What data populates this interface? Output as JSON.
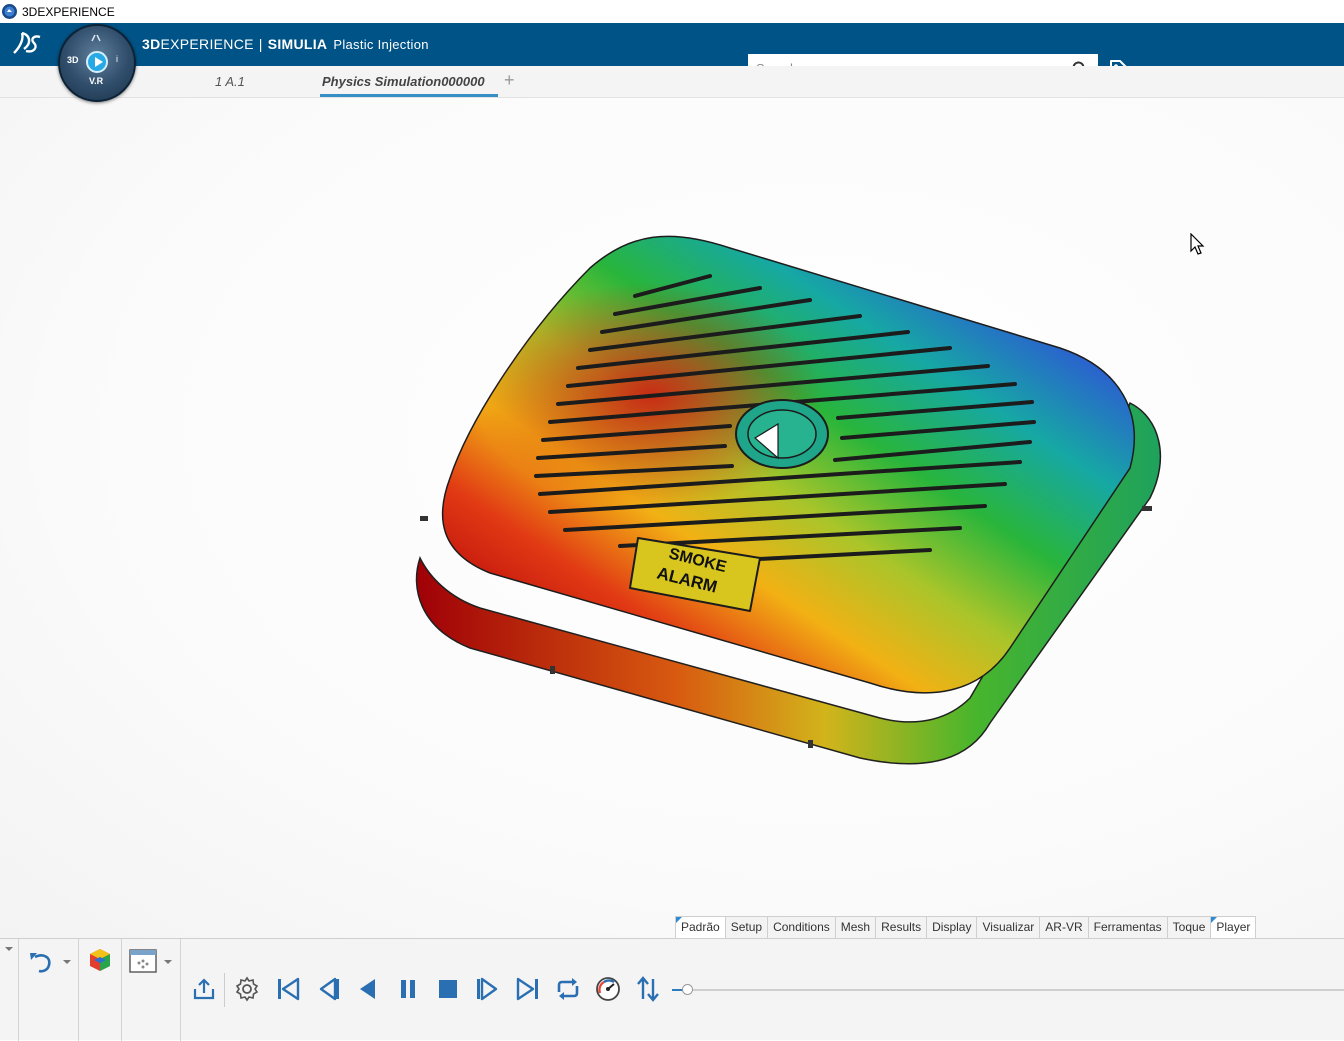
{
  "window": {
    "title": "3DEXPERIENCE"
  },
  "topbar": {
    "brand_3d": "3D",
    "brand_experience": "EXPERIENCE",
    "brand_sep": "|",
    "brand_simulia": "SIMULIA",
    "app_name": "Plastic Injection",
    "compass_3d": "3D",
    "compass_vr": "V.R",
    "search_placeholder": "Search"
  },
  "tabs": [
    {
      "label": "1 A.1"
    },
    {
      "label": "Physics Simulation000000"
    }
  ],
  "tab_add": "+",
  "model": {
    "label_line1": "SMOKE",
    "label_line2": "ALARM"
  },
  "section_tabs": [
    "Padrão",
    "Setup",
    "Conditions",
    "Mesh",
    "Results",
    "Display",
    "Visualizar",
    "AR-VR",
    "Ferramentas",
    "Toque",
    "Player"
  ],
  "player": {
    "progress": 0.0
  },
  "colors": {
    "topbar": "#005386",
    "accent": "#368ec4",
    "player_icon": "#2b6fb3"
  }
}
